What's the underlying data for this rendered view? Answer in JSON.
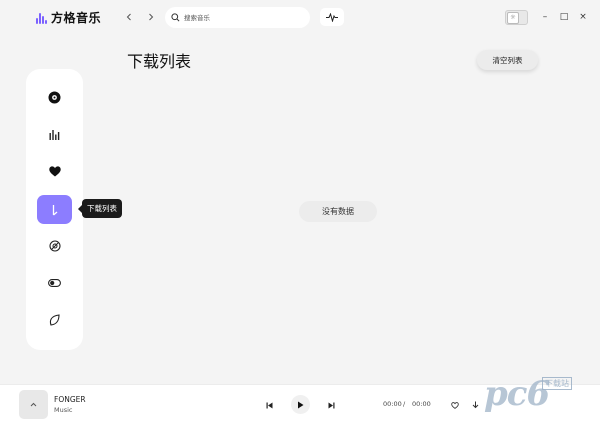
{
  "app": {
    "name": "方格音乐"
  },
  "header": {
    "back_icon": "chevron-left-icon",
    "forward_icon": "chevron-right-icon",
    "search_placeholder": "搜索音乐",
    "wave_icon": "waveform-icon"
  },
  "window": {
    "minimize": "–",
    "maximize": "□",
    "close": "×"
  },
  "sidebar": {
    "items": [
      {
        "id": "discover",
        "icon": "disc-icon"
      },
      {
        "id": "charts",
        "icon": "chart-bars-icon"
      },
      {
        "id": "favorites",
        "icon": "heart-icon"
      },
      {
        "id": "downloads",
        "icon": "download-list-icon",
        "active": true
      },
      {
        "id": "other1",
        "icon": "circle-slash-icon"
      },
      {
        "id": "settings",
        "icon": "toggle-icon"
      },
      {
        "id": "other2",
        "icon": "leaf-icon"
      }
    ],
    "tooltip": "下载列表"
  },
  "main": {
    "title": "下载列表",
    "clear_label": "清空列表",
    "empty_text": "没有数据"
  },
  "player": {
    "cover_icon": "chevron-up-icon",
    "song_title": "FONGER",
    "artist": "Music",
    "current_time": "00:00",
    "separator": "/",
    "total_time": "00:00"
  },
  "watermark": {
    "text": "pc6",
    "sub": "下载站"
  },
  "colors": {
    "accent": "#8c7dff",
    "background": "#f4f4f4"
  }
}
